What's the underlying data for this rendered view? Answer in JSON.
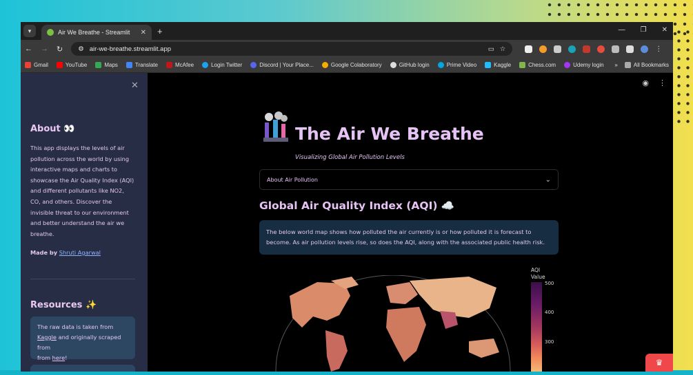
{
  "browser": {
    "tab_title": "Air We Breathe - Streamlit",
    "url": "air-we-breathe.streamlit.app",
    "bookmarks": [
      "Gmail",
      "YouTube",
      "Maps",
      "Translate",
      "McAfee",
      "Login Twitter",
      "Discord | Your Place...",
      "Google Colaboratory",
      "GitHub login",
      "Prime Video",
      "Kaggle",
      "Chess.com",
      "Udemy login"
    ],
    "bookmarks_folder": "All Bookmarks"
  },
  "sidebar": {
    "about_heading": "About 👀",
    "about_text": "This app displays the levels of air pollution across the world by using interactive maps and charts to showcase the Air Quality Index (AQI) and different pollutants like NO2, CO, and others. Discover the invisible threat to our environment and better understand the air we breathe.",
    "made_by_label": "Made by",
    "author": "Shruti Agarwal",
    "resources_heading": "Resources ✨",
    "resources_pre": "The raw data is taken from",
    "resources_kaggle": "Kaggle",
    "resources_mid": "and originally scraped from",
    "resources_here": "here",
    "resources_end": "!"
  },
  "main": {
    "title": "The Air We Breathe",
    "subtitle": "Visualizing Global Air Pollution Levels",
    "expander_label": "About Air Pollution",
    "section_title": "Global Air Quality Index (AQI) ☁️",
    "info_text": "The below world map shows how polluted the air currently is or how polluted it is forecast to become. As air pollution levels rise, so does the AQI, along with the associated public health risk.",
    "legend_title_1": "AQI",
    "legend_title_2": "Value",
    "legend_ticks": [
      "500",
      "400",
      "300"
    ]
  },
  "colors": {
    "sidebar_bg": "#262d44",
    "accent_text": "#e6c3f4",
    "info_bg": "#172d41"
  }
}
